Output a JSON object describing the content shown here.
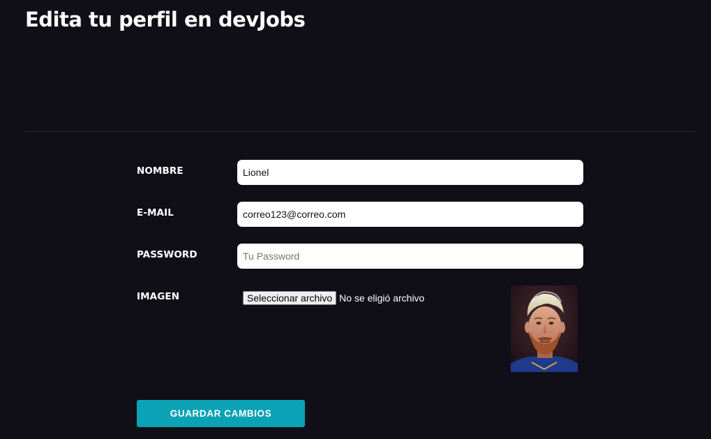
{
  "header": {
    "title": "Edita tu perfil en devJobs"
  },
  "form": {
    "nombre": {
      "label": "NOMBRE",
      "value": "Lionel"
    },
    "email": {
      "label": "E-MAIL",
      "value": "correo123@correo.com"
    },
    "password": {
      "label": "PASSWORD",
      "value": "",
      "placeholder": "Tu Password"
    },
    "imagen": {
      "label": "IMAGEN",
      "button_label": "Seleccionar archivo",
      "status_text": "No se eligió archivo"
    },
    "submit_label": "GUARDAR CAMBIOS"
  },
  "colors": {
    "background": "#100f17",
    "accent": "#0aa2b4"
  }
}
